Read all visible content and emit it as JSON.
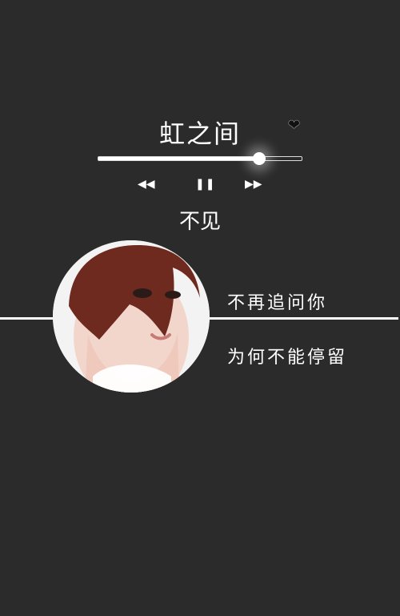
{
  "song": {
    "title": "虹之间",
    "favorite_icon": "heart-icon"
  },
  "player": {
    "progress": 0.79,
    "buttons": {
      "prev_label": "◀◀",
      "pause_label": "❚❚",
      "next_label": "▶▶"
    }
  },
  "lyrics": {
    "current": "不见",
    "line1": "不再追问你",
    "line2": "为何不能停留"
  },
  "colors": {
    "background": "#2b2b2b",
    "text": "#ffffff"
  }
}
